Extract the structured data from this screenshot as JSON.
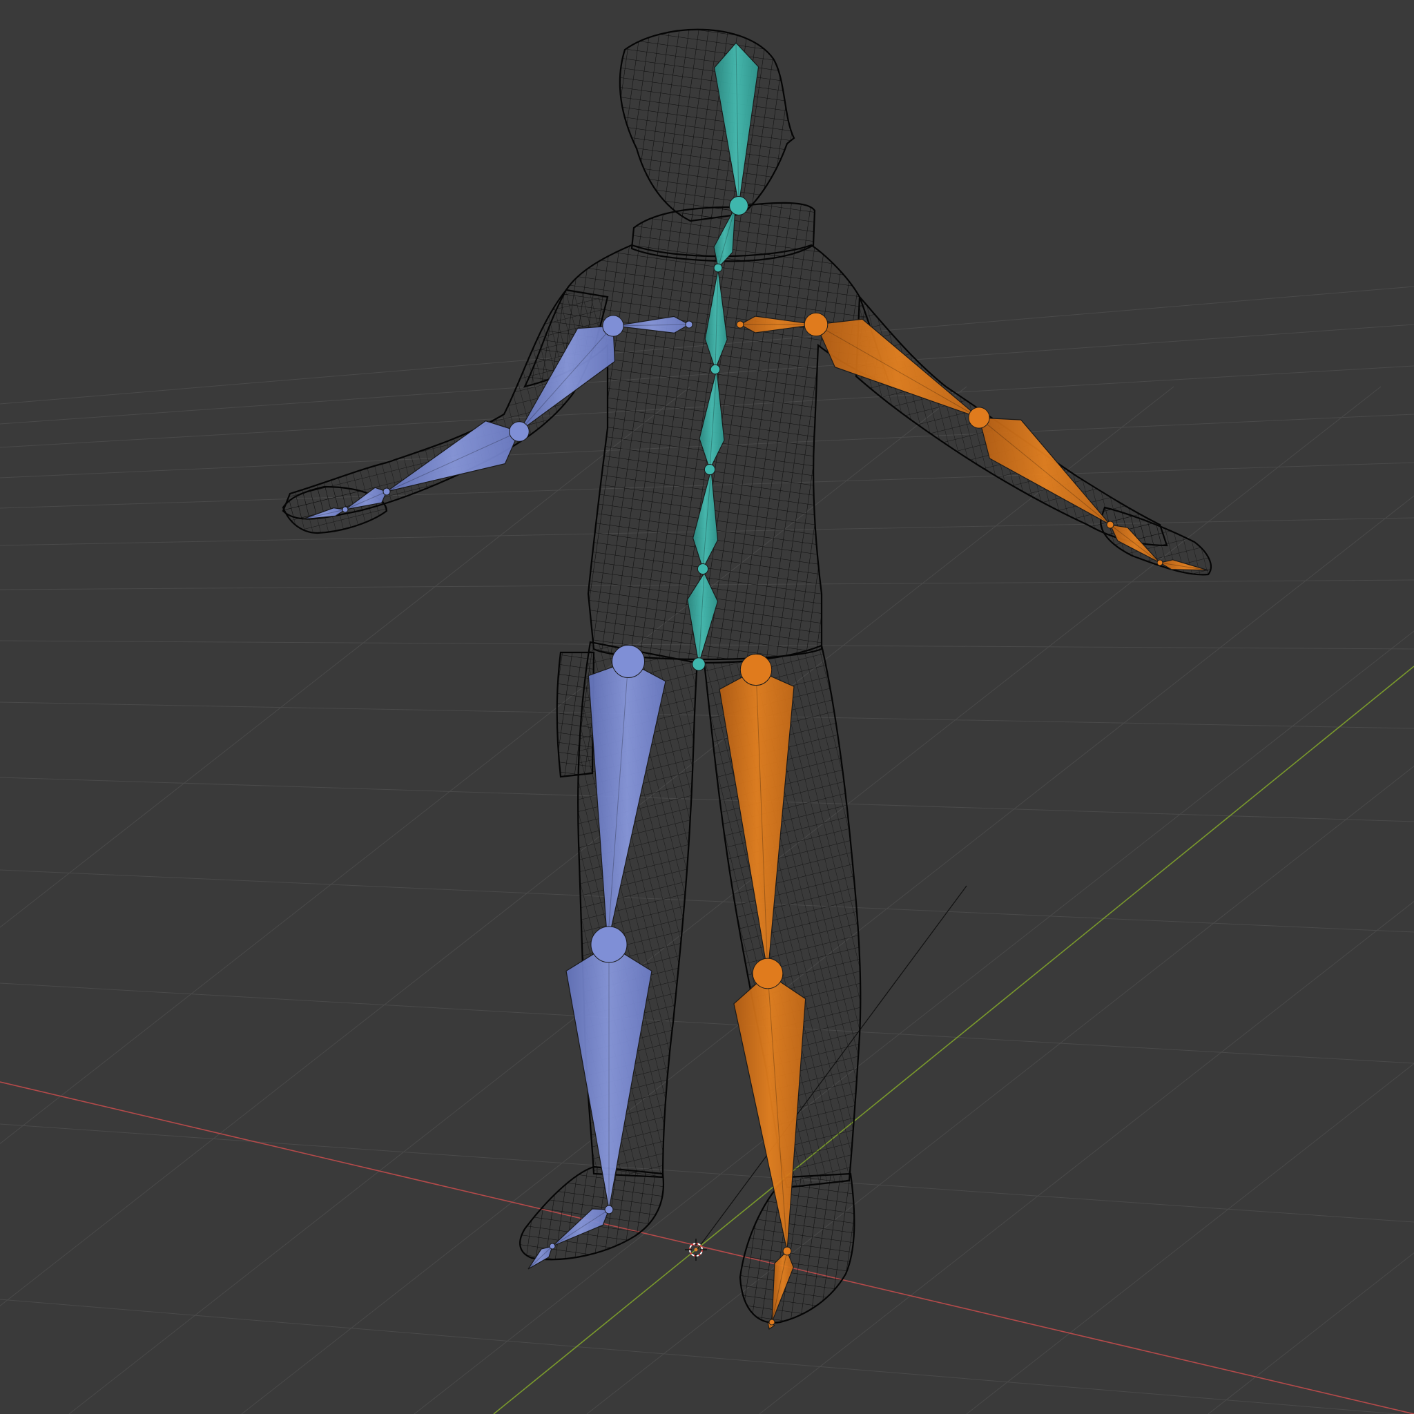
{
  "viewport": {
    "mode_label": "",
    "background": "#3a3a3a",
    "grid_color": "#4a4a4a",
    "axis_x_color": "#b54a4a",
    "axis_y_color": "#7a9a2c",
    "mesh_color": "#050505"
  },
  "rig": {
    "center_color": "#3fb7ad",
    "left_color": "#7f8fd6",
    "right_color": "#e07b1d"
  },
  "icons": {
    "origin": "3d-cursor-icon"
  }
}
